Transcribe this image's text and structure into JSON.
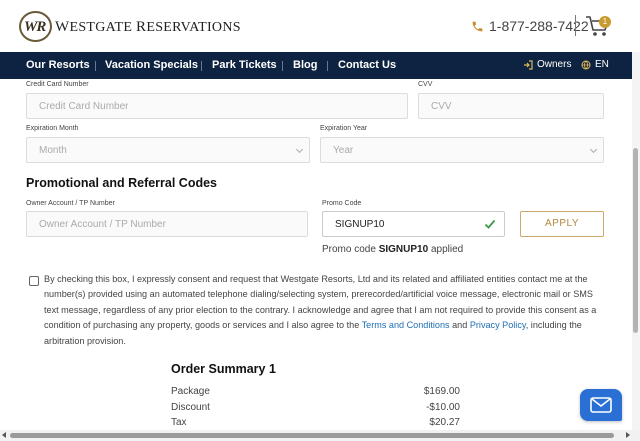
{
  "brand": {
    "logo_initials": "WR",
    "name_prefix": "W",
    "name_rest1": "ESTGATE ",
    "name_prefix2": "R",
    "name_rest2": "ESERVATIONS"
  },
  "header": {
    "phone": "1-877-288-7422",
    "cart_count": "1"
  },
  "nav": {
    "items": [
      "Our Resorts",
      "Vacation Specials",
      "Park Tickets",
      "Blog",
      "Contact Us"
    ],
    "owners": "Owners",
    "language": "EN"
  },
  "payment": {
    "card_label": "Credit Card Number",
    "card_placeholder": "Credit Card Number",
    "cvv_label": "CVV",
    "cvv_placeholder": "CVV",
    "month_label": "Expiration Month",
    "month_value": "Month",
    "year_label": "Expiration Year",
    "year_value": "Year"
  },
  "promo": {
    "title": "Promotional and Referral Codes",
    "owner_label": "Owner Account / TP Number",
    "owner_placeholder": "Owner Account / TP Number",
    "code_label": "Promo Code",
    "code_value": "SIGNUP10",
    "apply_label": "APPLY",
    "applied_prefix": "Promo code ",
    "applied_code": "SIGNUP10",
    "applied_suffix": " applied"
  },
  "consent": {
    "text_1": "By checking this box, I expressly consent and request that Westgate Resorts, Ltd and its related and affiliated entities contact me at the number(s) provided using an automated telephone dialing/selecting system, prerecorded/artificial voice message, electronic mail or SMS text message, regardless of any prior election to the contrary. I acknowledge and agree that I am not required to provide this consent as a condition of purchasing any property, goods or services and I also agree to the ",
    "terms_link": "Terms and Conditions",
    "and_text": " and ",
    "privacy_link": "Privacy Policy",
    "text_2": ", including the arbitration provision."
  },
  "summary": {
    "title": "Order Summary 1",
    "rows": [
      {
        "label": "Package",
        "value": "$169.00"
      },
      {
        "label": "Discount",
        "value": "-$10.00"
      },
      {
        "label": "Tax",
        "value": "$20.27"
      }
    ]
  },
  "colors": {
    "nav_bg": "#0e2341",
    "accent_gold": "#c9a868",
    "link_blue": "#1f6fb2",
    "chat_blue": "#2a6fd3",
    "check_green": "#3a9b49"
  }
}
